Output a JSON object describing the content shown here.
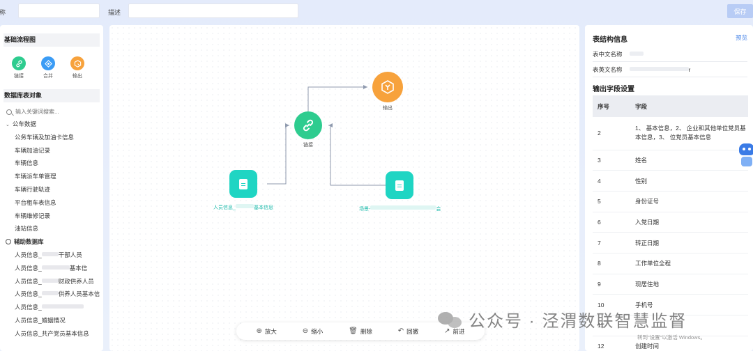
{
  "topbar": {
    "name_label": "名称",
    "desc_label": "描述",
    "name_value": "",
    "desc_value": "",
    "save_label": "保存"
  },
  "left": {
    "basic_title": "基础流程图",
    "tools": [
      {
        "label": "链接",
        "icon": "link-icon",
        "color": "#2ecc8f"
      },
      {
        "label": "合并",
        "icon": "merge-icon",
        "color": "#3b9cf5"
      },
      {
        "label": "输出",
        "icon": "output-icon",
        "color": "#f7a23c"
      }
    ],
    "db_title": "数据库表对象",
    "search_placeholder": "输入关键词搜索...",
    "group1": "公车数据",
    "group1_items": [
      "公务车辆及加油卡信息",
      "车辆加油记录",
      "车辆信息",
      "车辆派车单管理",
      "车辆行驶轨迹",
      "平台租车表信息",
      "车辆维修记录",
      "油站信息"
    ],
    "group2": "辅助数据库",
    "group2_items": [
      "人员信息_",
      "人员信息_",
      "人员信息_",
      "人员信息_",
      "人员信息_",
      "人员信息_婚姻情况",
      "人员信息_共产党员基本信息"
    ],
    "group2_suffixes": [
      "干部人员",
      "基本信",
      "财政供养人员",
      "供养人员基本信",
      "",
      "",
      ""
    ]
  },
  "canvas": {
    "nodes": {
      "link": "链接",
      "output": "输出",
      "person_prefix": "人员信息_",
      "person_suffix": "基本信息",
      "scene_prefix": "场景-",
      "scene_suffix": "会"
    },
    "toolbar": [
      "放大",
      "缩小",
      "删除",
      "回撤",
      "前进"
    ]
  },
  "right": {
    "title": "表结构信息",
    "preview": "预览",
    "cn_name_label": "表中文名称",
    "en_name_label": "表英文名称",
    "en_name_suffix": "r",
    "output_title": "输出字段设置",
    "col_index": "序号",
    "col_field": "字段",
    "rows": [
      {
        "n": "2",
        "f": "1、 基本信息，2、 企业和其他单位党员基本信息，3、 位党员基本信息"
      },
      {
        "n": "3",
        "f": "姓名"
      },
      {
        "n": "4",
        "f": "性别"
      },
      {
        "n": "5",
        "f": "身份证号"
      },
      {
        "n": "6",
        "f": "入党日期"
      },
      {
        "n": "7",
        "f": "转正日期"
      },
      {
        "n": "8",
        "f": "工作单位全程"
      },
      {
        "n": "9",
        "f": "现居住地"
      },
      {
        "n": "10",
        "f": "手机号"
      },
      {
        "n": "11",
        "f": ""
      },
      {
        "n": "12",
        "f": "创建时间"
      }
    ]
  },
  "watermark": "公众号 · 泾渭数联智慧监督",
  "activate_windows": "转到\"设置\"以激活 Windows。"
}
